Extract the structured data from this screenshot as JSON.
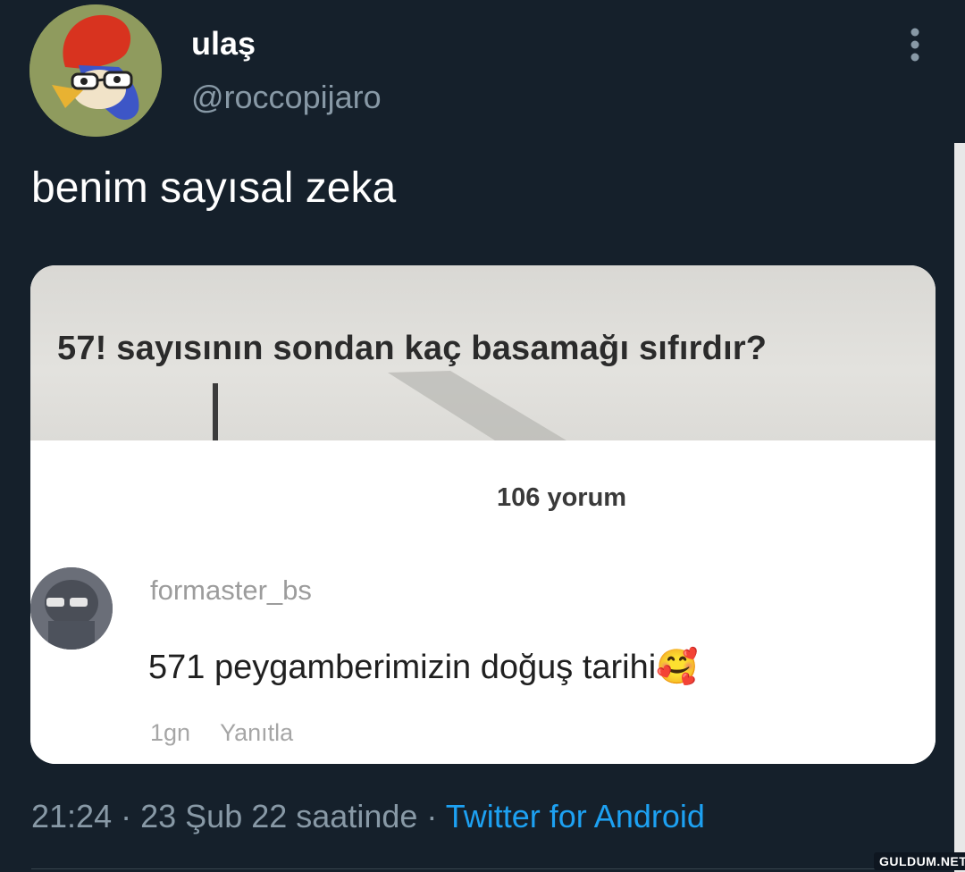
{
  "tweet": {
    "display_name": "ulaş",
    "handle": "@roccopijaro",
    "text": "benim sayısal zeka",
    "avatar_icon": "woody-woodpecker-avatar-icon",
    "more_icon": "more-vertical-icon"
  },
  "media": {
    "question": "57! sayısının sondan kaç basamağı sıfırdır?",
    "comment_count": "106 yorum",
    "comment": {
      "author": "formaster_bs",
      "text": "571 peygamberimizin doğuş tarihi",
      "emoji": "🥰",
      "time": "1gn",
      "reply_label": "Yanıtla",
      "avatar_icon": "commenter-avatar-icon"
    }
  },
  "footer": {
    "time": "21:24",
    "separator": "·",
    "date_text": "23 Şub 22 saatinde",
    "source": "Twitter for Android"
  },
  "watermark": "GULDUM.NET",
  "colors": {
    "background": "#15202b",
    "name": "#ffffff",
    "secondary": "#8899a6",
    "link": "#1da1f2"
  }
}
